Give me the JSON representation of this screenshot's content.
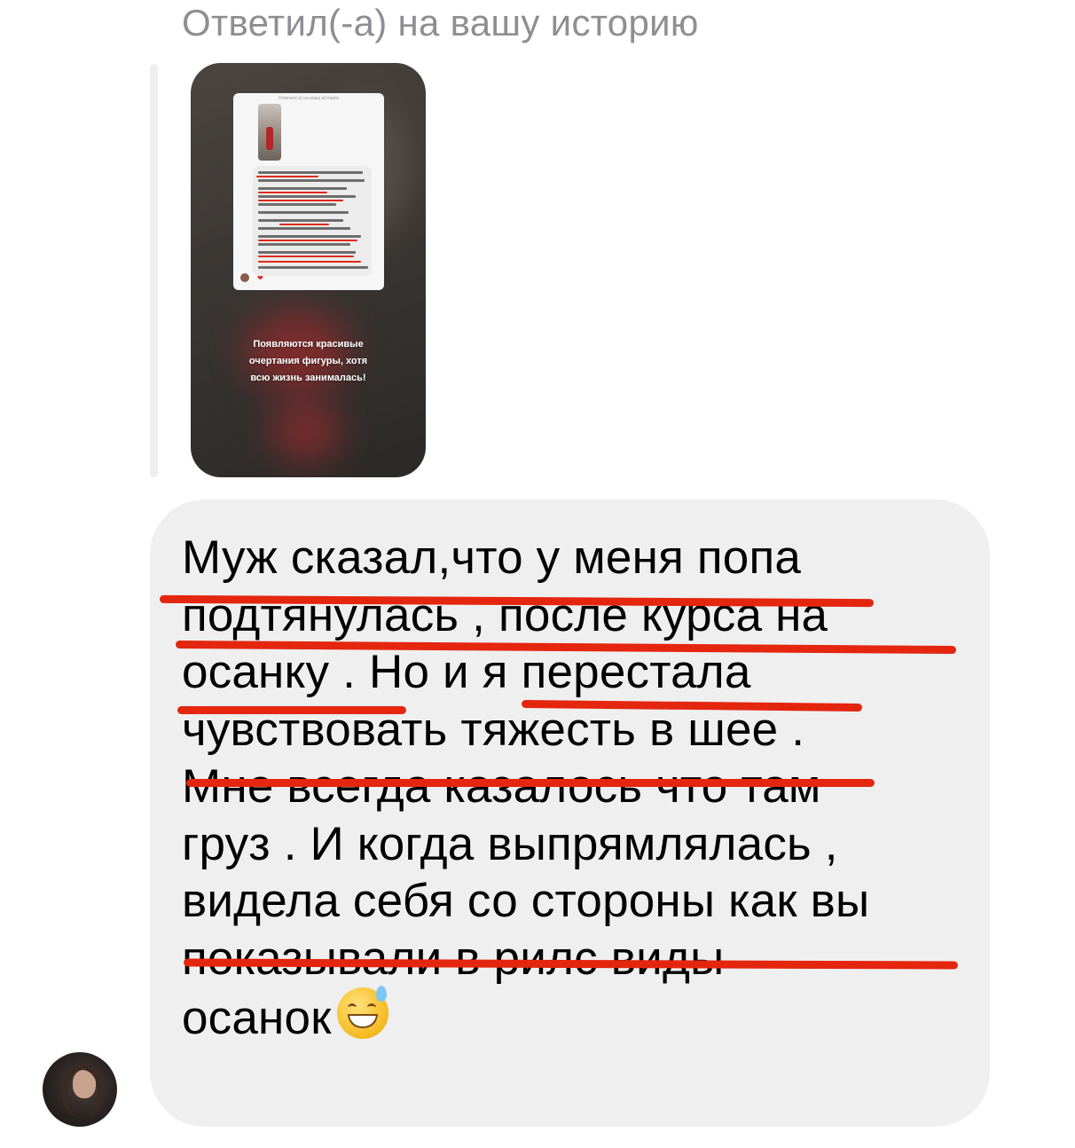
{
  "reply": {
    "header": "Ответил(-а) на вашу историю"
  },
  "story": {
    "screenshot_title": "Ответил(-а) на вашу историю",
    "caption": "Появляются красивые\nочертания фигуры, хотя\nвсю жизнь занималась!",
    "heart": "❤"
  },
  "message": {
    "lines": [
      "Муж сказал,что у меня попа",
      "подтянулась , после курса на",
      "осанку . Но и я перестала",
      "чувствовать тяжесть в шее .",
      "Мне всегда казалось что там",
      "груз . И когда выпрямлялась ,",
      "видела себя со стороны как вы",
      "показывали в рилс виды",
      "осанок"
    ],
    "emoji": "sweat-smile-emoji"
  },
  "colors": {
    "bubble": "#efefef",
    "underline": "#e4260f",
    "header": "#8e8e93"
  }
}
